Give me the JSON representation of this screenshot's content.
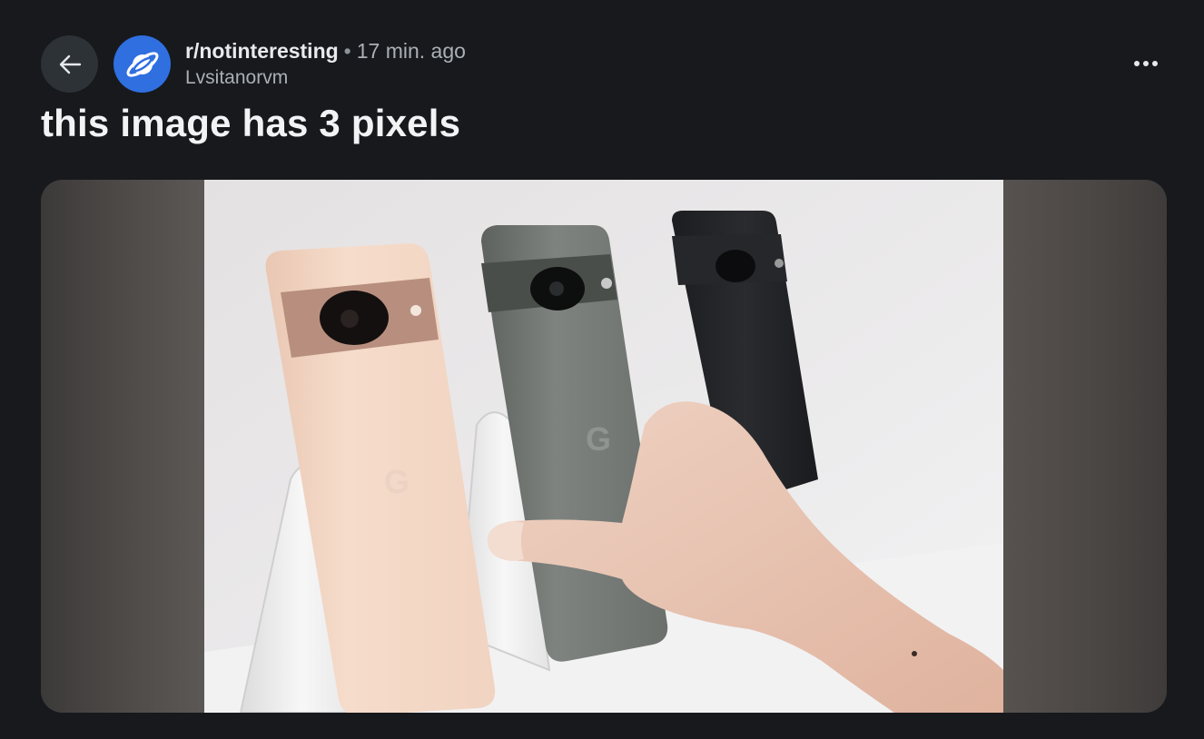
{
  "post": {
    "subreddit": "r/notinteresting",
    "separator": "•",
    "time_ago": "17 min. ago",
    "username": "Lvsitanorvm",
    "title": "this image has 3 pixels"
  },
  "icons": {
    "back": "arrow-left-icon",
    "avatar": "planet-icon",
    "more": "more-horizontal-icon"
  },
  "colors": {
    "background": "#17191c",
    "back_button_bg": "#2d3236",
    "avatar_bg": "#2f6fe0"
  },
  "media": {
    "phone_logo_letter": "G"
  }
}
